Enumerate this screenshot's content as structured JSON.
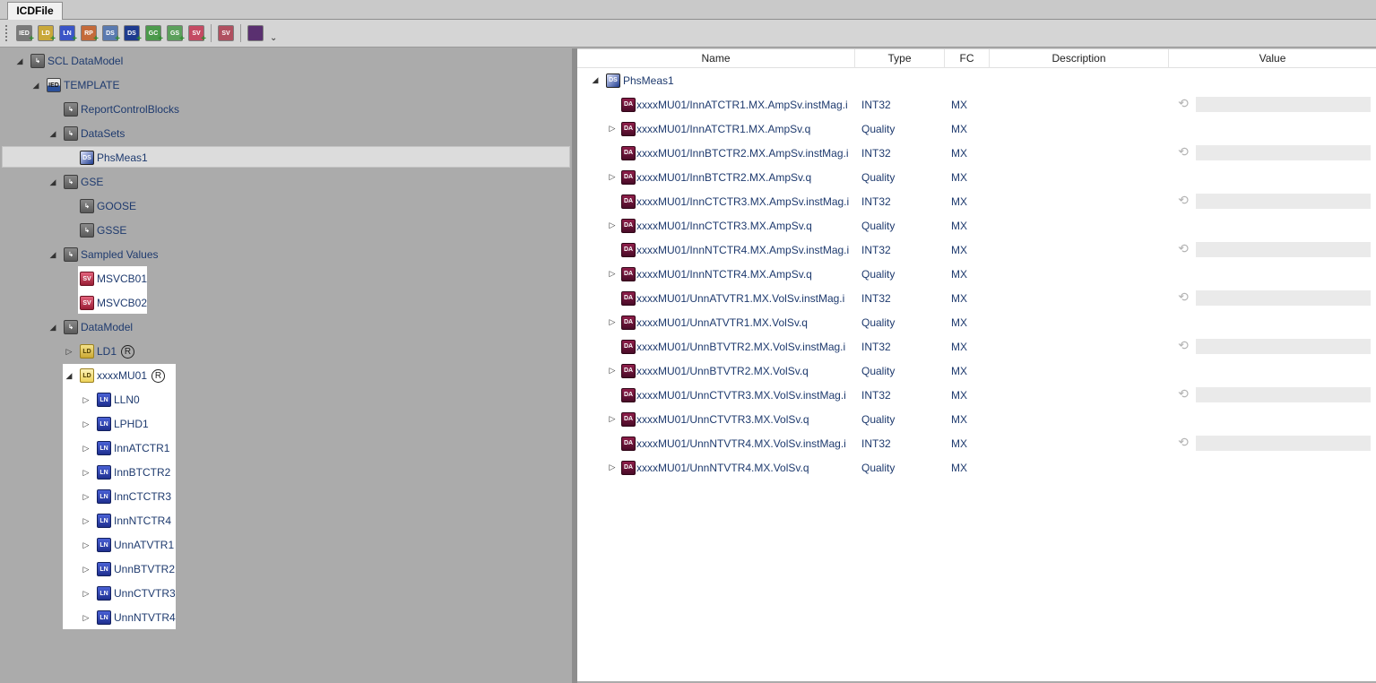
{
  "tab": {
    "label": "ICDFile"
  },
  "toolbar": {
    "buttons": [
      {
        "name": "new-ied-button",
        "icon": "IED",
        "color": "#7a7a7a"
      },
      {
        "name": "new-ld-button",
        "icon": "LD",
        "color": "#c9a83a"
      },
      {
        "name": "new-ln-button",
        "icon": "LN",
        "color": "#3b55c7"
      },
      {
        "name": "new-rp-button",
        "icon": "RP",
        "color": "#c46a3a"
      },
      {
        "name": "new-ds-button",
        "icon": "DS",
        "color": "#5a7ab0"
      },
      {
        "name": "new-ds2-button",
        "icon": "DS",
        "color": "#1e3b8f"
      },
      {
        "name": "new-gc-button",
        "icon": "GC",
        "color": "#4c9a4c"
      },
      {
        "name": "new-gs-button",
        "icon": "GS",
        "color": "#5ca05c"
      },
      {
        "name": "new-sv-button",
        "icon": "SV",
        "color": "#c44a63"
      },
      {
        "name": "sv-goose-button",
        "icon": "SV",
        "color": "#b05060"
      },
      {
        "name": "window-button",
        "icon": "",
        "color": "#5a3070"
      }
    ],
    "more": "⌄"
  },
  "tree": {
    "root": "SCL DataModel",
    "template": "TEMPLATE",
    "report_control_blocks": "ReportControlBlocks",
    "datasets": "DataSets",
    "phsmeas": "PhsMeas1",
    "gse": "GSE",
    "goose": "GOOSE",
    "gsse": "GSSE",
    "sampled_values": "Sampled Values",
    "msvcb01": "MSVCB01",
    "msvcb02": "MSVCB02",
    "datamodel": "DataModel",
    "ld1": "LD1",
    "ld_mark": "R",
    "mu01": "xxxxMU01",
    "ln_nodes": [
      "LLN0",
      "LPHD1",
      "InnATCTR1",
      "InnBTCTR2",
      "InnCTCTR3",
      "InnNTCTR4",
      "UnnATVTR1",
      "UnnBTVTR2",
      "UnnCTVTR3",
      "UnnNTVTR4"
    ]
  },
  "grid": {
    "headers": {
      "name": "Name",
      "type": "Type",
      "fc": "FC",
      "description": "Description",
      "value": "Value"
    },
    "dataset": "PhsMeas1",
    "rows": [
      {
        "name": "xxxxMU01/InnATCTR1.MX.AmpSv.instMag.i",
        "type": "INT32",
        "fc": "MX",
        "expandable": false,
        "value": ""
      },
      {
        "name": "xxxxMU01/InnATCTR1.MX.AmpSv.q",
        "type": "Quality",
        "fc": "MX",
        "expandable": true
      },
      {
        "name": "xxxxMU01/InnBTCTR2.MX.AmpSv.instMag.i",
        "type": "INT32",
        "fc": "MX",
        "expandable": false,
        "value": ""
      },
      {
        "name": "xxxxMU01/InnBTCTR2.MX.AmpSv.q",
        "type": "Quality",
        "fc": "MX",
        "expandable": true
      },
      {
        "name": "xxxxMU01/InnCTCTR3.MX.AmpSv.instMag.i",
        "type": "INT32",
        "fc": "MX",
        "expandable": false,
        "value": ""
      },
      {
        "name": "xxxxMU01/InnCTCTR3.MX.AmpSv.q",
        "type": "Quality",
        "fc": "MX",
        "expandable": true
      },
      {
        "name": "xxxxMU01/InnNTCTR4.MX.AmpSv.instMag.i",
        "type": "INT32",
        "fc": "MX",
        "expandable": false,
        "value": ""
      },
      {
        "name": "xxxxMU01/InnNTCTR4.MX.AmpSv.q",
        "type": "Quality",
        "fc": "MX",
        "expandable": true
      },
      {
        "name": "xxxxMU01/UnnATVTR1.MX.VolSv.instMag.i",
        "type": "INT32",
        "fc": "MX",
        "expandable": false,
        "value": ""
      },
      {
        "name": "xxxxMU01/UnnATVTR1.MX.VolSv.q",
        "type": "Quality",
        "fc": "MX",
        "expandable": true
      },
      {
        "name": "xxxxMU01/UnnBTVTR2.MX.VolSv.instMag.i",
        "type": "INT32",
        "fc": "MX",
        "expandable": false,
        "value": ""
      },
      {
        "name": "xxxxMU01/UnnBTVTR2.MX.VolSv.q",
        "type": "Quality",
        "fc": "MX",
        "expandable": true
      },
      {
        "name": "xxxxMU01/UnnCTVTR3.MX.VolSv.instMag.i",
        "type": "INT32",
        "fc": "MX",
        "expandable": false,
        "value": ""
      },
      {
        "name": "xxxxMU01/UnnCTVTR3.MX.VolSv.q",
        "type": "Quality",
        "fc": "MX",
        "expandable": true
      },
      {
        "name": "xxxxMU01/UnnNTVTR4.MX.VolSv.instMag.i",
        "type": "INT32",
        "fc": "MX",
        "expandable": false,
        "value": ""
      },
      {
        "name": "xxxxMU01/UnnNTVTR4.MX.VolSv.q",
        "type": "Quality",
        "fc": "MX",
        "expandable": true
      }
    ]
  },
  "colors": {
    "text": "#1e3a6e",
    "pane_bg": "#ababab",
    "selection": "#dcdcdc",
    "value_field": "#eaeaea"
  },
  "icons": {
    "expanded": "◢",
    "collapsed": "▷",
    "reset": "⟲"
  }
}
